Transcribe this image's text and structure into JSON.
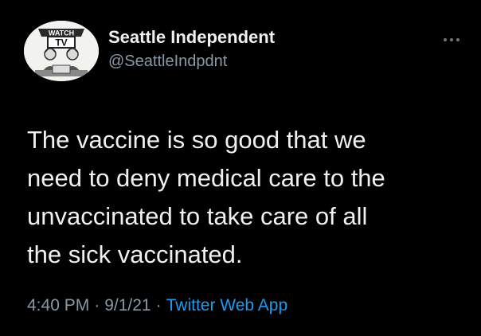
{
  "author": {
    "name": "Seattle Independent",
    "handle": "@SeattleIndpdnt",
    "avatar_logo_text": "WATCH TV"
  },
  "more_icon": "more-options-icon",
  "tweet": {
    "lines": [
      "The vaccine is so good that we",
      "need to deny medical care to the",
      "unvaccinated to take care of all",
      "the sick vaccinated."
    ]
  },
  "meta": {
    "time": "4:40 PM",
    "separator": "·",
    "date": "9/1/21",
    "source": "Twitter Web App"
  },
  "colors": {
    "background": "#000000",
    "link": "#1d9bf0",
    "secondary_text": "#8b98a5"
  }
}
